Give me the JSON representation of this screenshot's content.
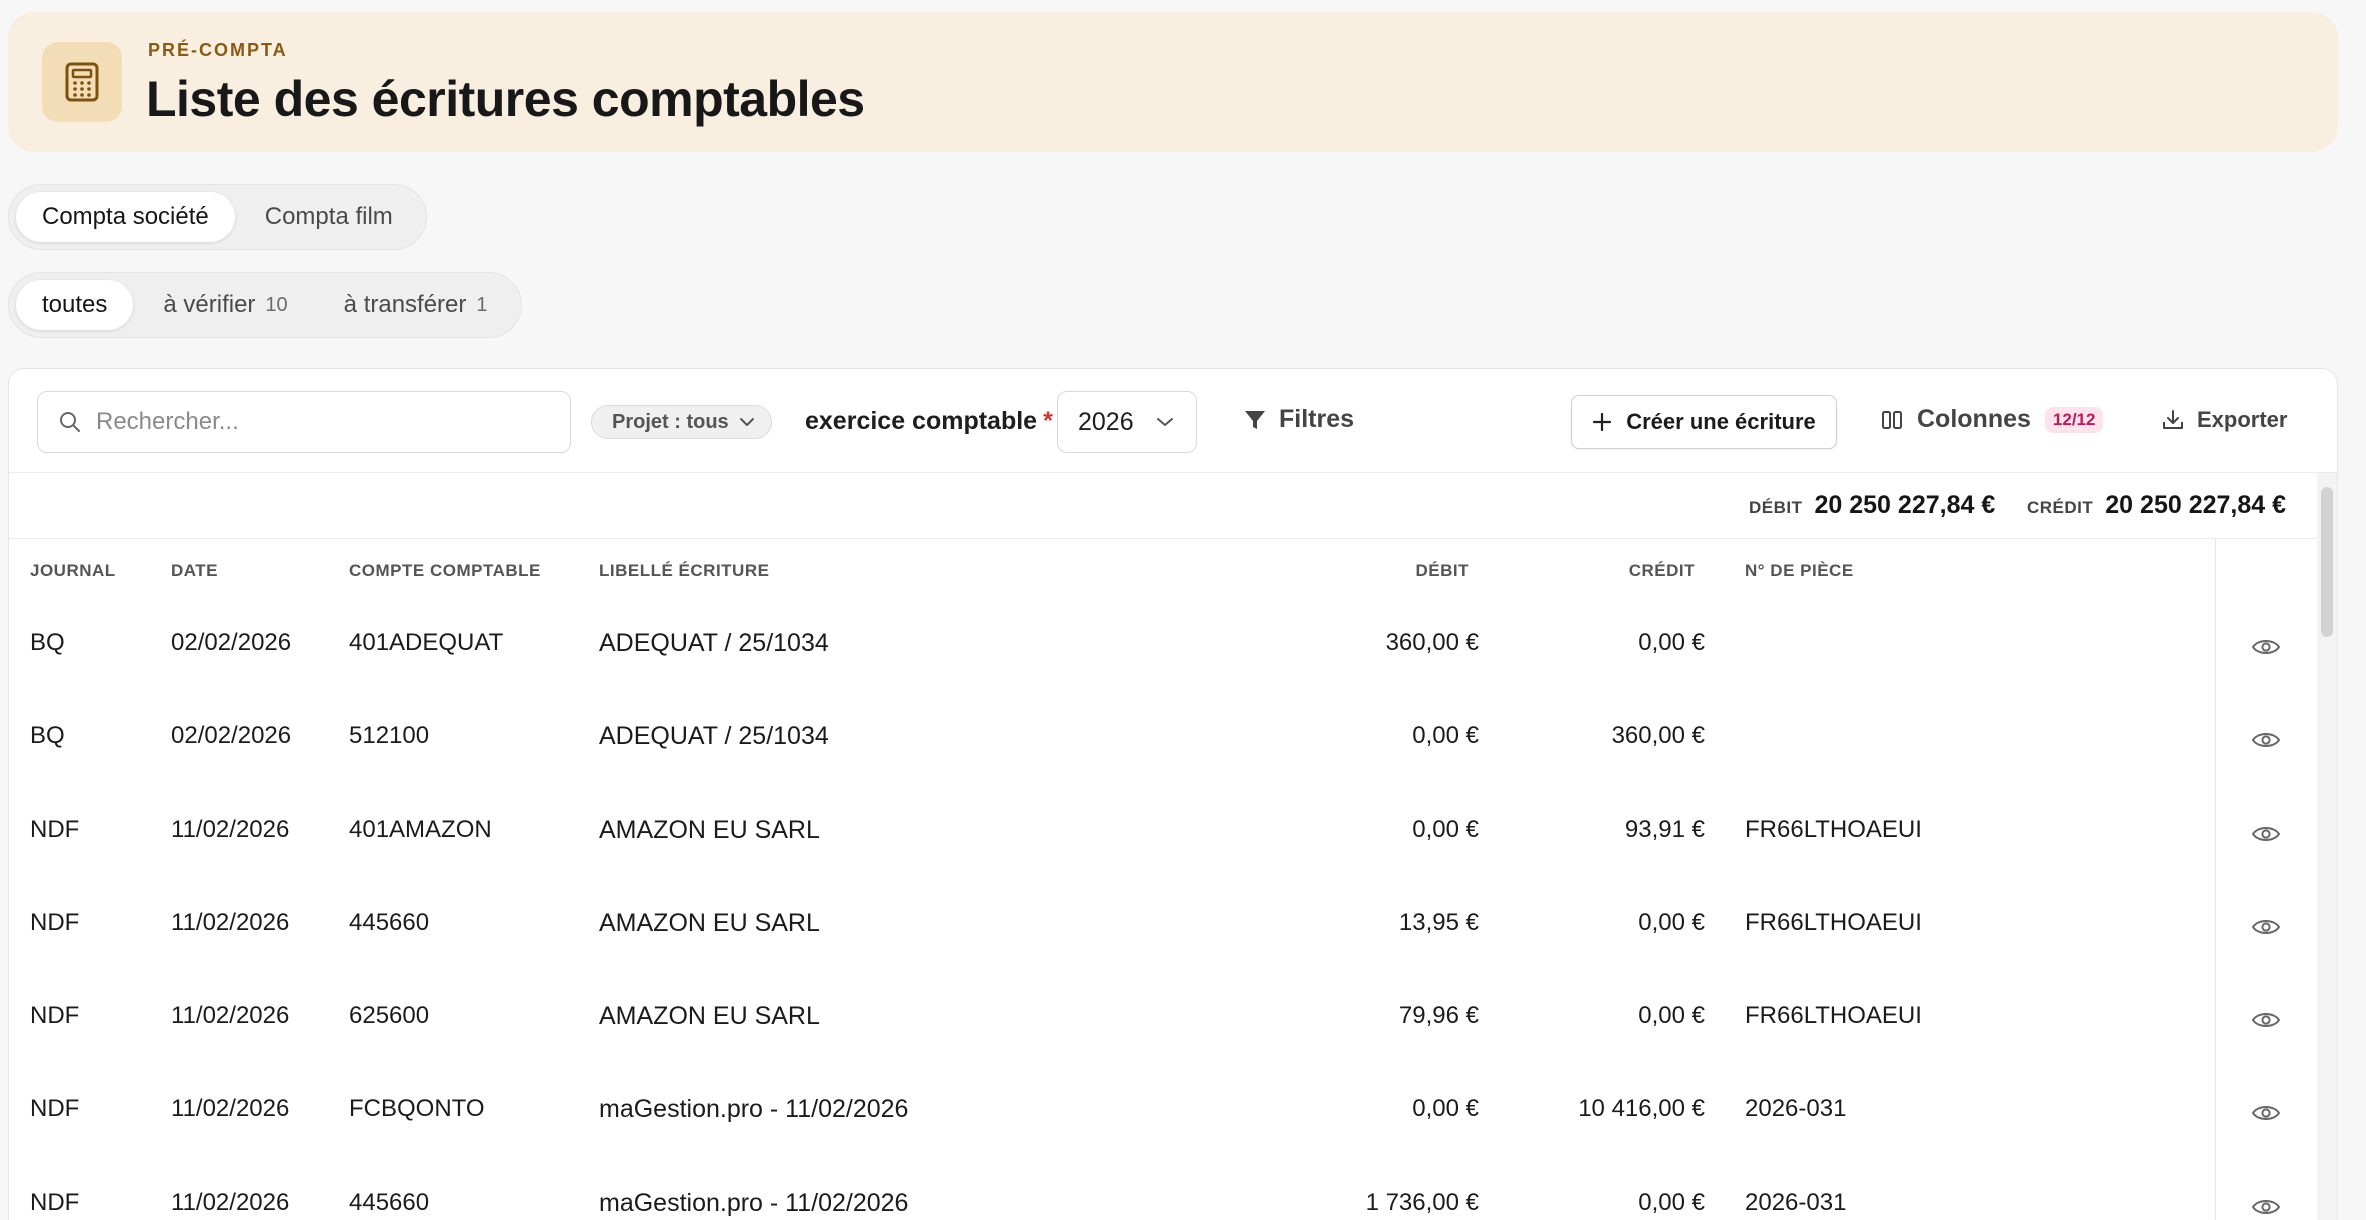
{
  "header": {
    "kicker": "PRÉ-COMPTA",
    "title": "Liste des écritures comptables",
    "icon": "calculator-icon"
  },
  "scope_tabs": [
    {
      "label": "Compta société",
      "active": true
    },
    {
      "label": "Compta film",
      "active": false
    }
  ],
  "status_tabs": [
    {
      "label": "toutes",
      "count": "",
      "active": true
    },
    {
      "label": "à vérifier",
      "count": "10",
      "active": false
    },
    {
      "label": "à transférer",
      "count": "1",
      "active": false
    }
  ],
  "toolbar": {
    "search_placeholder": "Rechercher...",
    "project_filter": "Projet : tous",
    "exercise_label": "exercice comptable",
    "exercise_required": "*",
    "exercise_value": "2026",
    "filters_label": "Filtres",
    "create_label": "Créer une écriture",
    "columns_label": "Colonnes",
    "columns_badge": "12/12",
    "export_label": "Exporter"
  },
  "totals": {
    "debit_label": "DÉBIT",
    "debit_value": "20 250 227,84 €",
    "credit_label": "CRÉDIT",
    "credit_value": "20 250 227,84 €"
  },
  "table": {
    "headers": {
      "journal": "JOURNAL",
      "date": "DATE",
      "compte": "COMPTE COMPTABLE",
      "libelle": "LIBELLÉ ÉCRITURE",
      "debit": "DÉBIT",
      "credit": "CRÉDIT",
      "piece": "N° DE PIÈCE"
    },
    "rows": [
      {
        "journal": "BQ",
        "date": "02/02/2026",
        "compte": "401ADEQUAT",
        "libelle": "ADEQUAT / 25/1034",
        "debit": "360,00 €",
        "credit": "0,00 €",
        "piece": ""
      },
      {
        "journal": "BQ",
        "date": "02/02/2026",
        "compte": "512100",
        "libelle": "ADEQUAT / 25/1034",
        "debit": "0,00 €",
        "credit": "360,00 €",
        "piece": ""
      },
      {
        "journal": "NDF",
        "date": "11/02/2026",
        "compte": "401AMAZON",
        "libelle": "AMAZON EU SARL",
        "debit": "0,00 €",
        "credit": "93,91 €",
        "piece": "FR66LTHOAEUI"
      },
      {
        "journal": "NDF",
        "date": "11/02/2026",
        "compte": "445660",
        "libelle": "AMAZON EU SARL",
        "debit": "13,95 €",
        "credit": "0,00 €",
        "piece": "FR66LTHOAEUI"
      },
      {
        "journal": "NDF",
        "date": "11/02/2026",
        "compte": "625600",
        "libelle": "AMAZON EU SARL",
        "debit": "79,96 €",
        "credit": "0,00 €",
        "piece": "FR66LTHOAEUI"
      },
      {
        "journal": "NDF",
        "date": "11/02/2026",
        "compte": "FCBQONTO",
        "libelle": "maGestion.pro - 11/02/2026",
        "debit": "0,00 €",
        "credit": "10 416,00 €",
        "piece": "2026-031"
      },
      {
        "journal": "NDF",
        "date": "11/02/2026",
        "compte": "445660",
        "libelle": "maGestion.pro - 11/02/2026",
        "debit": "1 736,00 €",
        "credit": "0,00 €",
        "piece": "2026-031"
      }
    ]
  }
}
